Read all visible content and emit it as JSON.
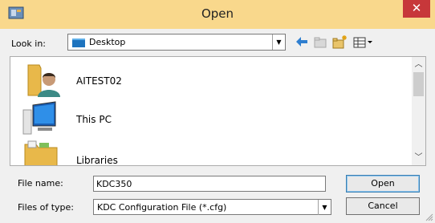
{
  "window": {
    "title": "Open",
    "close_glyph": "✕"
  },
  "look_in": {
    "label": "Look in:",
    "value": "Desktop",
    "icon": "desktop-folder-icon"
  },
  "toolbar": {
    "icons": [
      "back-arrow-icon",
      "up-folder-icon",
      "new-folder-icon",
      "view-menu-icon"
    ]
  },
  "files": [
    {
      "name": "AITEST02",
      "icon": "user-folder-icon"
    },
    {
      "name": "This PC",
      "icon": "computer-icon"
    },
    {
      "name": "Libraries",
      "icon": "libraries-folder-icon"
    }
  ],
  "file_name": {
    "label": "File name:",
    "value": "KDC350"
  },
  "file_type": {
    "label": "Files of type:",
    "value": "KDC Configuration File (*.cfg)"
  },
  "buttons": {
    "open": "Open",
    "cancel": "Cancel"
  },
  "colors": {
    "titlebar": "#f9d88c",
    "close": "#c7373a"
  }
}
